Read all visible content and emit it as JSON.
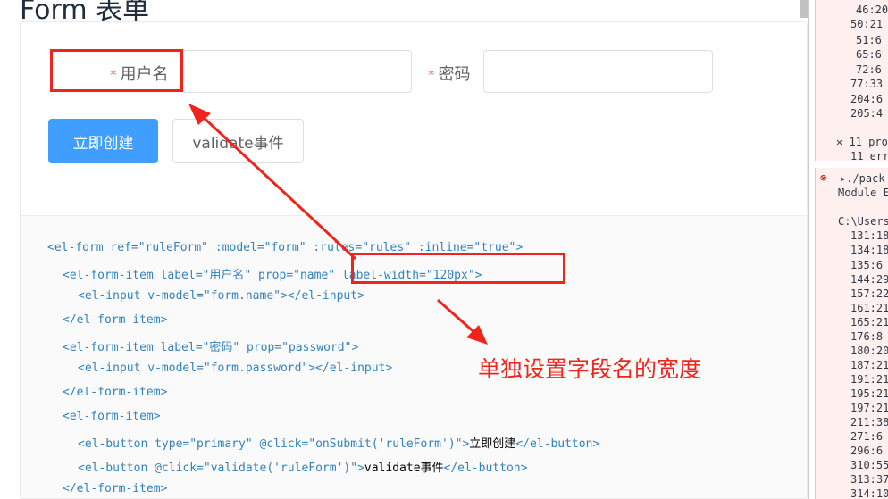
{
  "page": {
    "title": "Form 表单"
  },
  "form": {
    "name_label": "用户名",
    "password_label": "密码",
    "required_mark": "*",
    "name_value": "",
    "password_value": "",
    "submit_button": "立即创建",
    "validate_button": "validate事件"
  },
  "code": {
    "l1": {
      "p1": "<el-form ref=\"ruleForm\" :model=\"form\" :rules=\"rules\" :inline=\"true\">"
    },
    "l2": {
      "p1": "<el-form-item label=\"用户名\" prop=\"name\" label-width=\"120px\">"
    },
    "l3": {
      "p1": "<el-input v-model=\"form.name\"></el-input>"
    },
    "l4": {
      "p1": "</el-form-item>"
    },
    "l5": {
      "p1": "<el-form-item label=\"密码\" prop=\"password\">"
    },
    "l6": {
      "p1": "<el-input v-model=\"form.password\"></el-input>"
    },
    "l7": {
      "p1": "</el-form-item>"
    },
    "l8": {
      "p1": "<el-form-item>"
    },
    "l9": {
      "p1": "<el-button type=\"primary\" @click=\"onSubmit('ruleForm')\">",
      "p2": "立即创建",
      "p3": "</el-button>"
    },
    "l10": {
      "p1": "<el-button @click=\"validate('ruleForm')\">",
      "p2": "validate事件",
      "p3": "</el-button>"
    },
    "l11": {
      "p1": "</el-form-item>"
    }
  },
  "annotation": {
    "text": "单独设置字段名的宽度",
    "color": "#f1241d"
  },
  "console": {
    "lines_top": [
      "46:20",
      "50:21",
      "51:6",
      "65:6",
      "72:6",
      "77:33",
      "204:6",
      "205:4"
    ],
    "err_summary_1": "✕ 11 pro",
    "err_summary_2": "11 err",
    "err_path": "▸./pack",
    "err_module": "Module E",
    "err_users": "C:\\Users",
    "lines_bottom": [
      "131:18",
      "134:18",
      "135:6",
      "144:29",
      "157:22",
      "161:21",
      "165:21",
      "176:8",
      "180:20",
      "187:21",
      "191:21",
      "195:21",
      "197:21",
      "211:38",
      "271:6",
      "296:6",
      "310:55",
      "313:37",
      "314:10"
    ]
  },
  "colors": {
    "primary": "#409eff",
    "danger": "#f56c6c",
    "annotation": "#f1241d"
  }
}
